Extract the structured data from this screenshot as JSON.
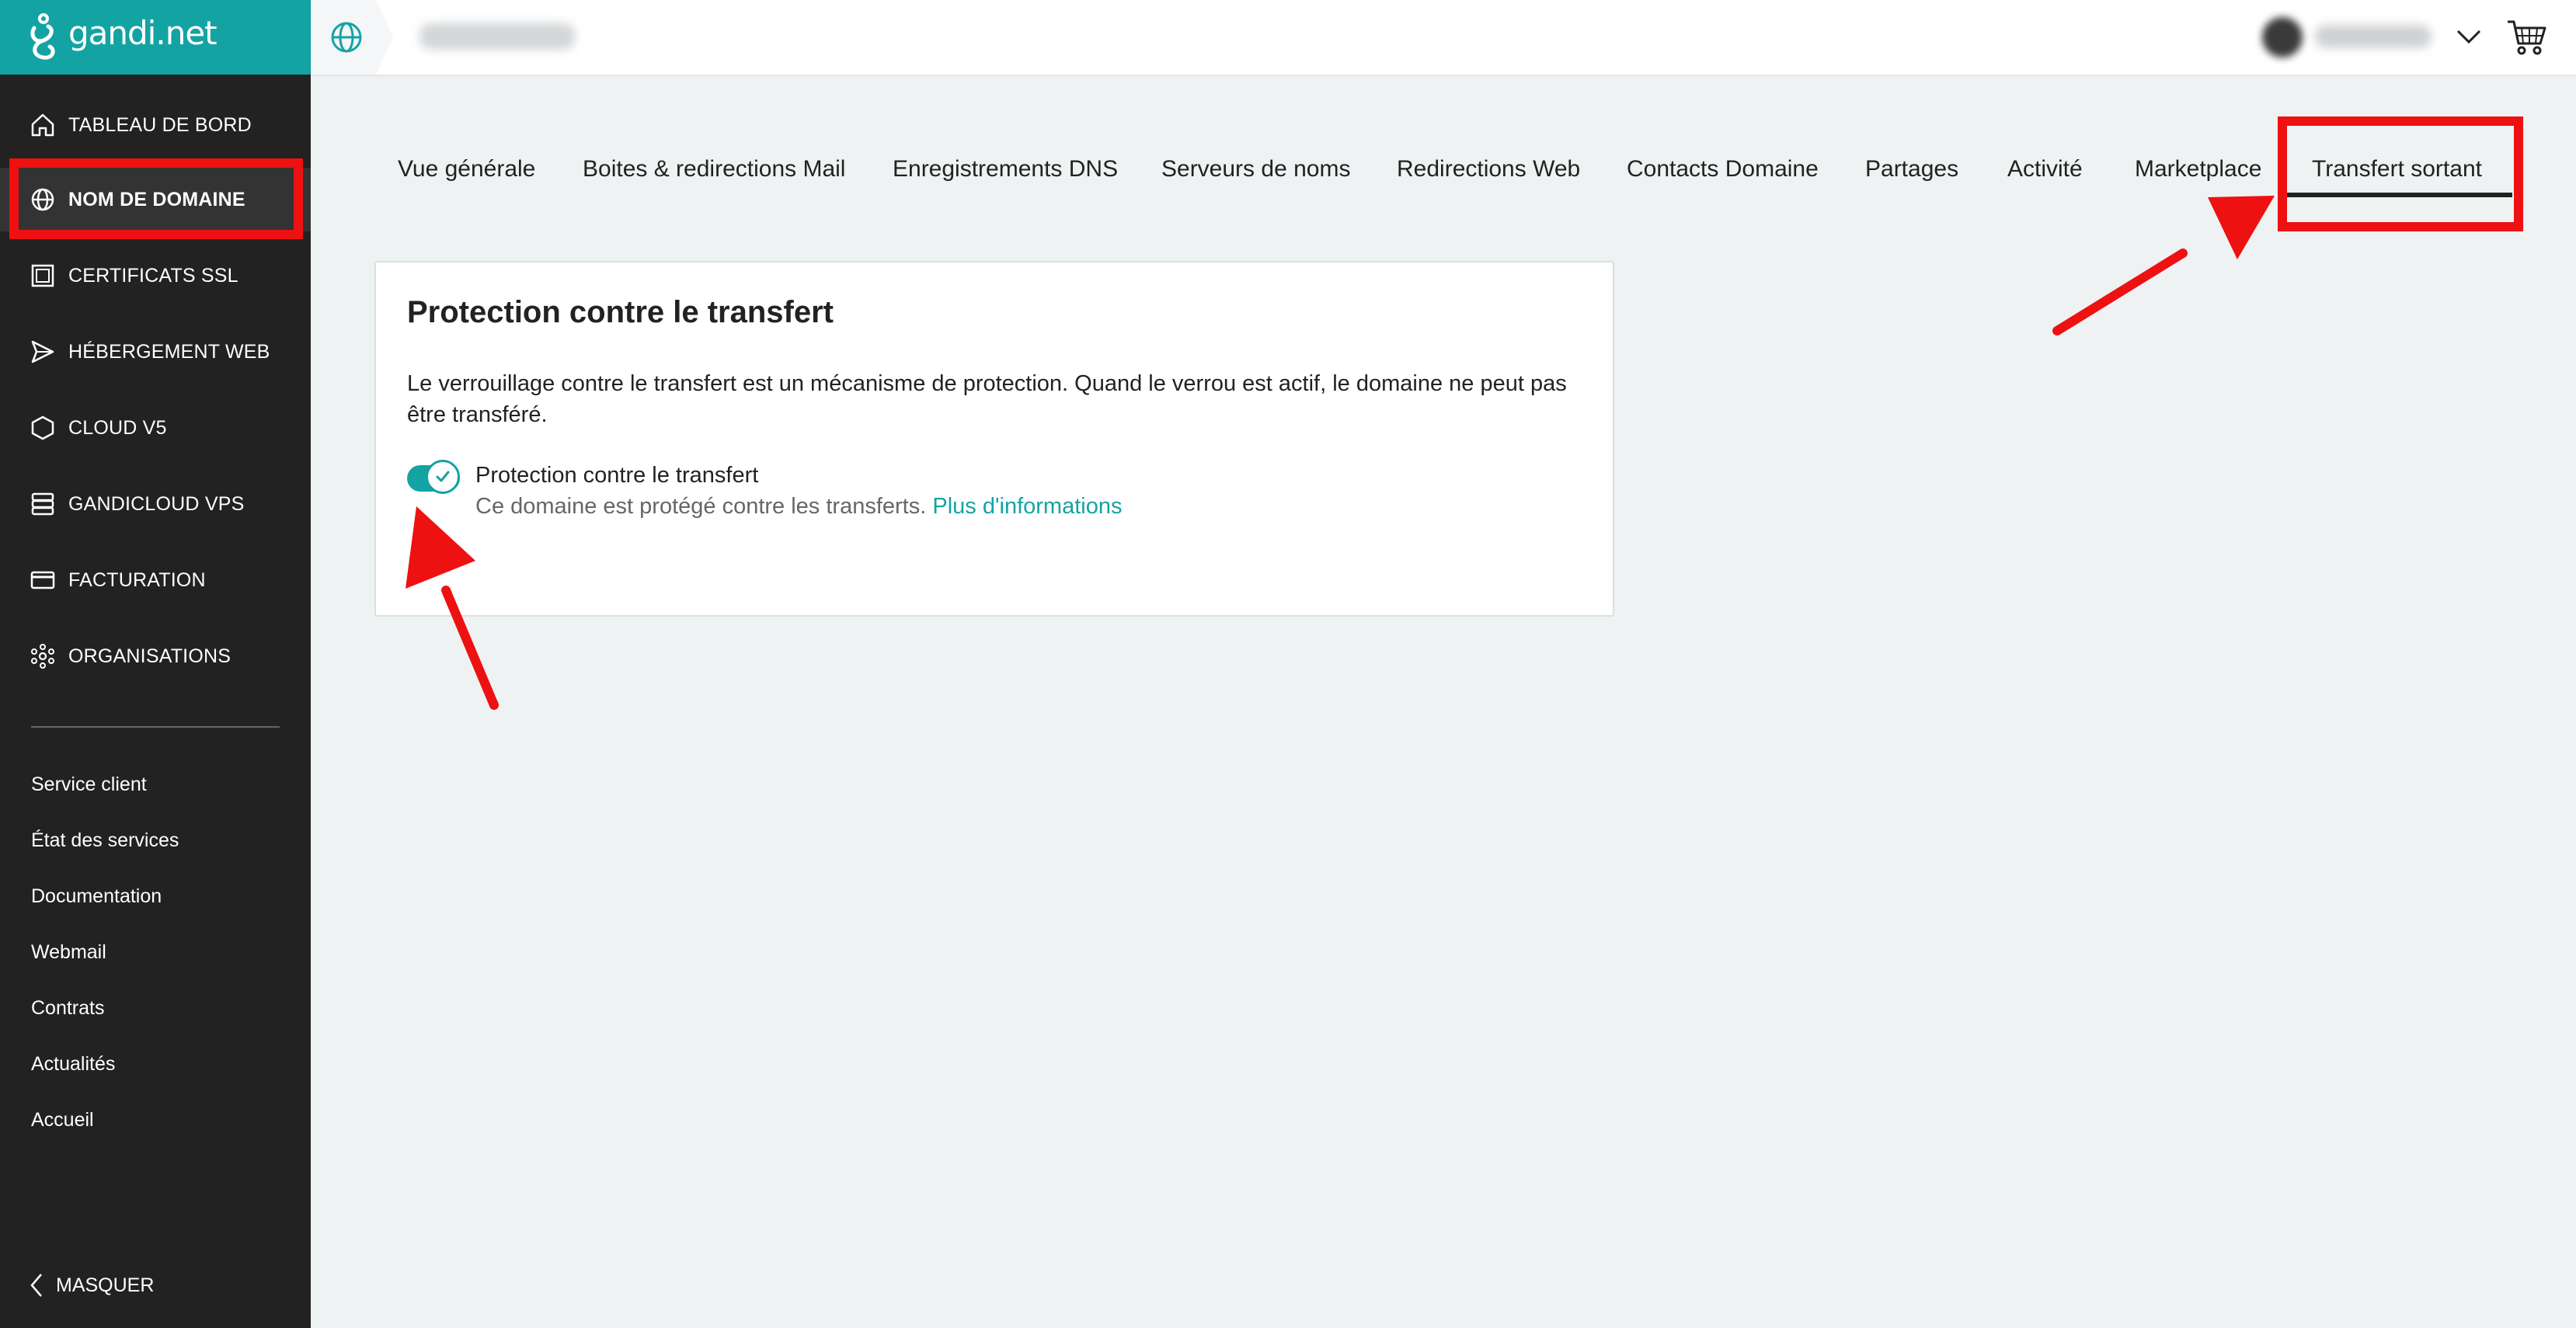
{
  "app": {
    "logo_text": "gandi.net",
    "accent_color": "#14a3a3"
  },
  "sidebar": {
    "items": [
      {
        "label": "TABLEAU DE BORD",
        "icon": "home-icon"
      },
      {
        "label": "NOM DE DOMAINE",
        "icon": "globe-icon",
        "active": true
      },
      {
        "label": "CERTIFICATS SSL",
        "icon": "certificate-icon"
      },
      {
        "label": "HÉBERGEMENT WEB",
        "icon": "send-icon"
      },
      {
        "label": "CLOUD V5",
        "icon": "cube-icon"
      },
      {
        "label": "GANDICLOUD VPS",
        "icon": "server-icon"
      },
      {
        "label": "FACTURATION",
        "icon": "credit-card-icon"
      },
      {
        "label": "ORGANISATIONS",
        "icon": "network-icon"
      }
    ],
    "secondary_links": [
      "Service client",
      "État des services",
      "Documentation",
      "Webmail",
      "Contrats",
      "Actualités",
      "Accueil"
    ],
    "hide_label": "MASQUER"
  },
  "topbar": {
    "icons": [
      "globe-icon",
      "chevron-down-icon",
      "cart-icon"
    ]
  },
  "tabs": [
    "Vue générale",
    "Boites & redirections Mail",
    "Enregistrements DNS",
    "Serveurs de noms",
    "Redirections Web",
    "Contacts Domaine",
    "Partages",
    "Activité",
    "Marketplace",
    "Transfert sortant"
  ],
  "active_tab": "Transfert sortant",
  "card": {
    "title": "Protection contre le transfert",
    "description": "Le verrouillage contre le transfert est un mécanisme de protection. Quand le verrou est actif, le domaine ne peut pas être transféré.",
    "toggle": {
      "enabled": true,
      "label": "Protection contre le transfert",
      "hint": "Ce domaine est protégé contre les transferts.",
      "link": "Plus d'informations"
    }
  },
  "annotation_color": "#ee1111"
}
